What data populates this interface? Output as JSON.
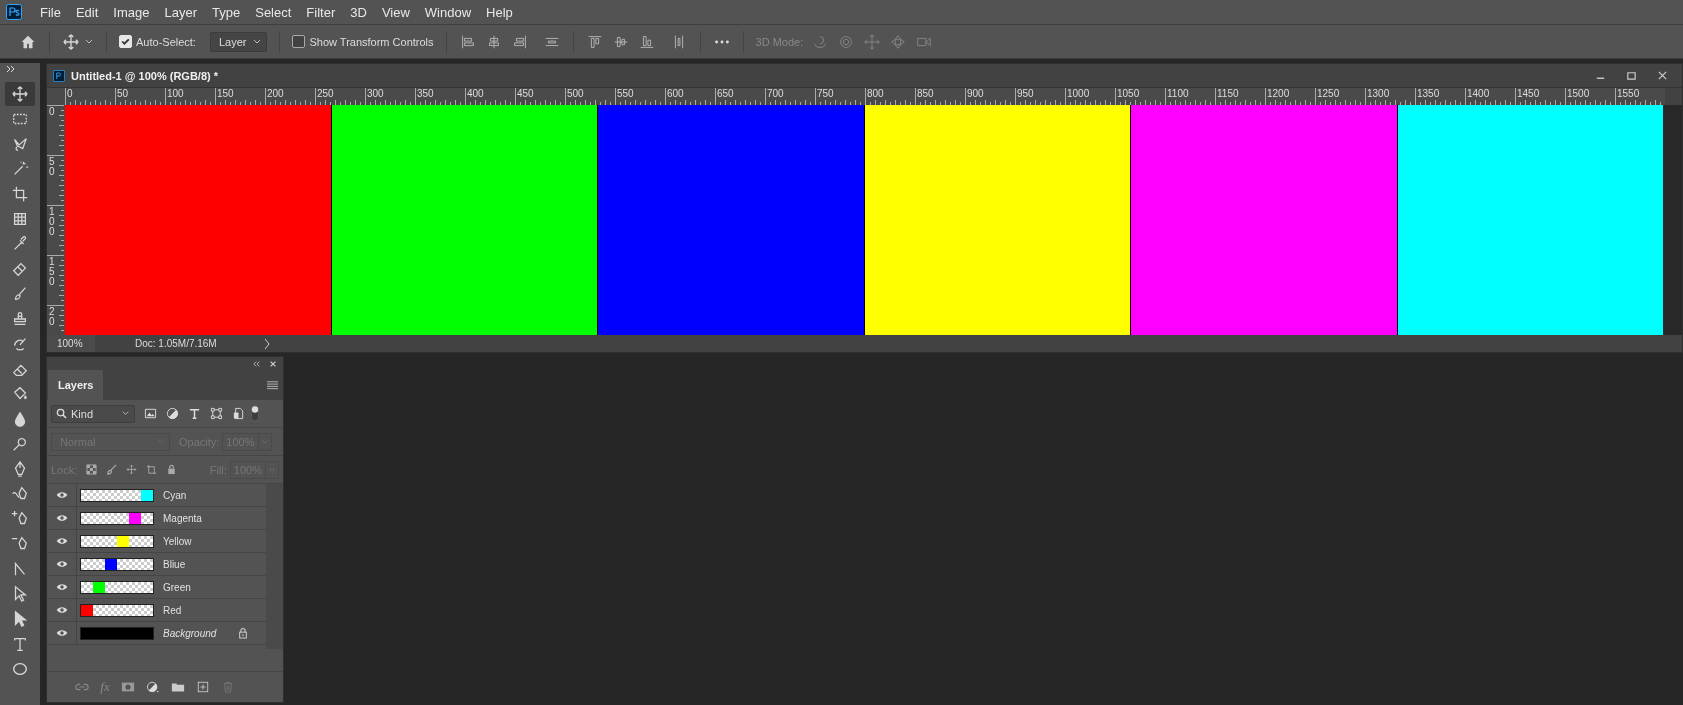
{
  "menu": [
    "File",
    "Edit",
    "Image",
    "Layer",
    "Type",
    "Select",
    "Filter",
    "3D",
    "View",
    "Window",
    "Help"
  ],
  "options_bar": {
    "auto_select": {
      "label": "Auto-Select:",
      "checked": true
    },
    "target": "Layer",
    "transform_controls": {
      "label": "Show Transform Controls",
      "checked": false
    },
    "mode_label": "3D Mode:"
  },
  "tools": [
    {
      "kind": "move",
      "selected": true
    },
    {
      "kind": "marquee",
      "selected": false
    },
    {
      "kind": "lasso",
      "selected": false
    },
    {
      "kind": "wand",
      "selected": false
    },
    {
      "kind": "crop",
      "selected": false
    },
    {
      "kind": "frame",
      "selected": false
    },
    {
      "kind": "eyedropper",
      "selected": false
    },
    {
      "kind": "healing",
      "selected": false
    },
    {
      "kind": "brush",
      "selected": false
    },
    {
      "kind": "stamp",
      "selected": false
    },
    {
      "kind": "history",
      "selected": false
    },
    {
      "kind": "eraser",
      "selected": false
    },
    {
      "kind": "bucket",
      "selected": false
    },
    {
      "kind": "blur",
      "selected": false
    },
    {
      "kind": "dodge",
      "selected": false
    },
    {
      "kind": "pen",
      "selected": false
    },
    {
      "kind": "freeform",
      "selected": false
    },
    {
      "kind": "add-anchor",
      "selected": false
    },
    {
      "kind": "delete-anchor",
      "selected": false
    },
    {
      "kind": "convert",
      "selected": false
    },
    {
      "kind": "path-select",
      "selected": false
    },
    {
      "kind": "direct-select",
      "selected": false
    },
    {
      "kind": "type",
      "selected": false
    },
    {
      "kind": "ellipse",
      "selected": false
    }
  ],
  "document": {
    "title": "Untitled-1 @ 100% (RGB/8) *",
    "ruler_horizontal": [
      "0",
      "50",
      "100",
      "150",
      "200",
      "250",
      "300",
      "350",
      "400",
      "450",
      "500",
      "550",
      "600",
      "650",
      "700",
      "750",
      "800",
      "850",
      "900",
      "950",
      "1000",
      "1050",
      "1100",
      "1150",
      "1200",
      "1250",
      "1300",
      "1350",
      "1400",
      "1450",
      "1500",
      "1550"
    ],
    "ruler_vertical": [
      "0",
      "50",
      "100",
      "150",
      "20"
    ],
    "zoom": "100%",
    "doc_info": "Doc: 1.05M/7.16M"
  },
  "layers_panel": {
    "tab": "Layers",
    "filter": "Kind",
    "blend_mode": {
      "value": "Normal",
      "disabled": true
    },
    "opacity": {
      "label": "Opacity:",
      "value": "100%",
      "disabled": true
    },
    "lock_label": "Lock:",
    "fill": {
      "label": "Fill:",
      "value": "100%",
      "disabled": true
    },
    "fx": "fx",
    "layers": [
      {
        "name": "Cyan",
        "kind": "pixel",
        "color": "#00ffff",
        "visible": true
      },
      {
        "name": "Magenta",
        "kind": "pixel",
        "color": "#ff00ff",
        "visible": true
      },
      {
        "name": "Yellow",
        "kind": "pixel",
        "color": "#ffff00",
        "visible": true
      },
      {
        "name": "Bliue",
        "kind": "pixel",
        "color": "#0000ff",
        "visible": true
      },
      {
        "name": "Green",
        "kind": "pixel",
        "color": "#00ff00",
        "visible": true
      },
      {
        "name": "Red",
        "kind": "pixel",
        "color": "#ff0000",
        "visible": true
      },
      {
        "name": "Background",
        "kind": "background",
        "color": "#000000",
        "visible": true
      }
    ]
  }
}
